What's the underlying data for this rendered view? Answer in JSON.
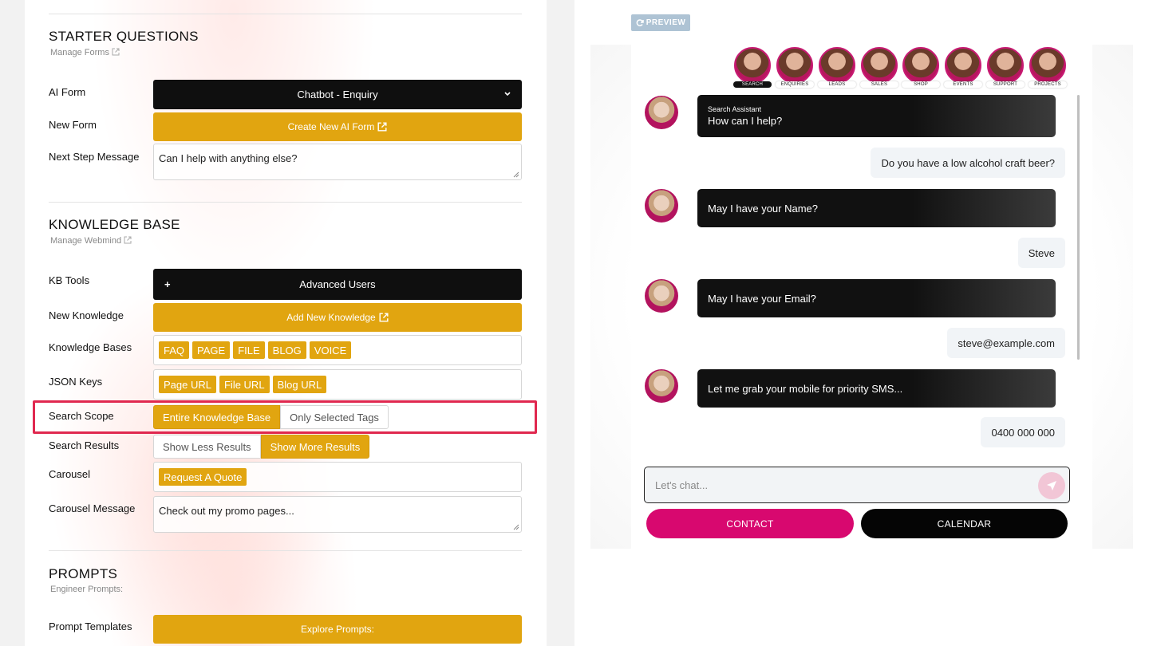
{
  "starter": {
    "title": "STARTER QUESTIONS",
    "sub": "Manage Forms",
    "ai_form_label": "AI Form",
    "ai_form_value": "Chatbot - Enquiry",
    "new_form_label": "New Form",
    "new_form_button": "Create New AI Form",
    "next_step_label": "Next Step Message",
    "next_step_value": "Can I help with anything else?"
  },
  "kb": {
    "title": "KNOWLEDGE BASE",
    "sub": "Manage Webmind",
    "tools_label": "KB Tools",
    "tools_value": "Advanced Users",
    "new_label": "New Knowledge",
    "new_button": "Add New Knowledge",
    "bases_label": "Knowledge Bases",
    "bases": [
      "FAQ",
      "PAGE",
      "FILE",
      "BLOG",
      "VOICE"
    ],
    "json_label": "JSON Keys",
    "json_keys": [
      "Page URL",
      "File URL",
      "Blog URL"
    ],
    "scope_label": "Search Scope",
    "scope_options": [
      "Entire Knowledge Base",
      "Only Selected Tags"
    ],
    "results_label": "Search Results",
    "results_options": [
      "Show Less Results",
      "Show More Results"
    ],
    "carousel_label": "Carousel",
    "carousel_tag": "Request A Quote",
    "carousel_msg_label": "Carousel Message",
    "carousel_msg_value": "Check out my promo pages..."
  },
  "prompts": {
    "title": "PROMPTS",
    "sub": "Engineer Prompts:",
    "templates_label": "Prompt Templates",
    "templates_button": "Explore Prompts:"
  },
  "preview": {
    "badge": "PREVIEW",
    "agents": [
      "SEARCH",
      "ENQUIRIES",
      "LEADS",
      "SALES",
      "SHOP",
      "EVENTS",
      "SUPPORT",
      "PROJECTS"
    ],
    "assistant_name": "Search Assistant",
    "messages": [
      {
        "from": "bot",
        "text": "How can I help?"
      },
      {
        "from": "user",
        "text": "Do you have a low alcohol craft beer?"
      },
      {
        "from": "bot",
        "text": "May I have your Name?"
      },
      {
        "from": "user",
        "text": "Steve"
      },
      {
        "from": "bot",
        "text": "May I have your Email?"
      },
      {
        "from": "user",
        "text": "steve@example.com"
      },
      {
        "from": "bot",
        "text": "Let me grab your mobile for priority SMS..."
      },
      {
        "from": "user",
        "text": "0400 000 000"
      }
    ],
    "input_placeholder": "Let's chat...",
    "contact_button": "CONTACT",
    "calendar_button": "CALENDAR"
  },
  "colors": {
    "gold": "#e1a510",
    "black": "#0f0f0f",
    "pink": "#d8086f",
    "highlight": "#e0284f"
  }
}
